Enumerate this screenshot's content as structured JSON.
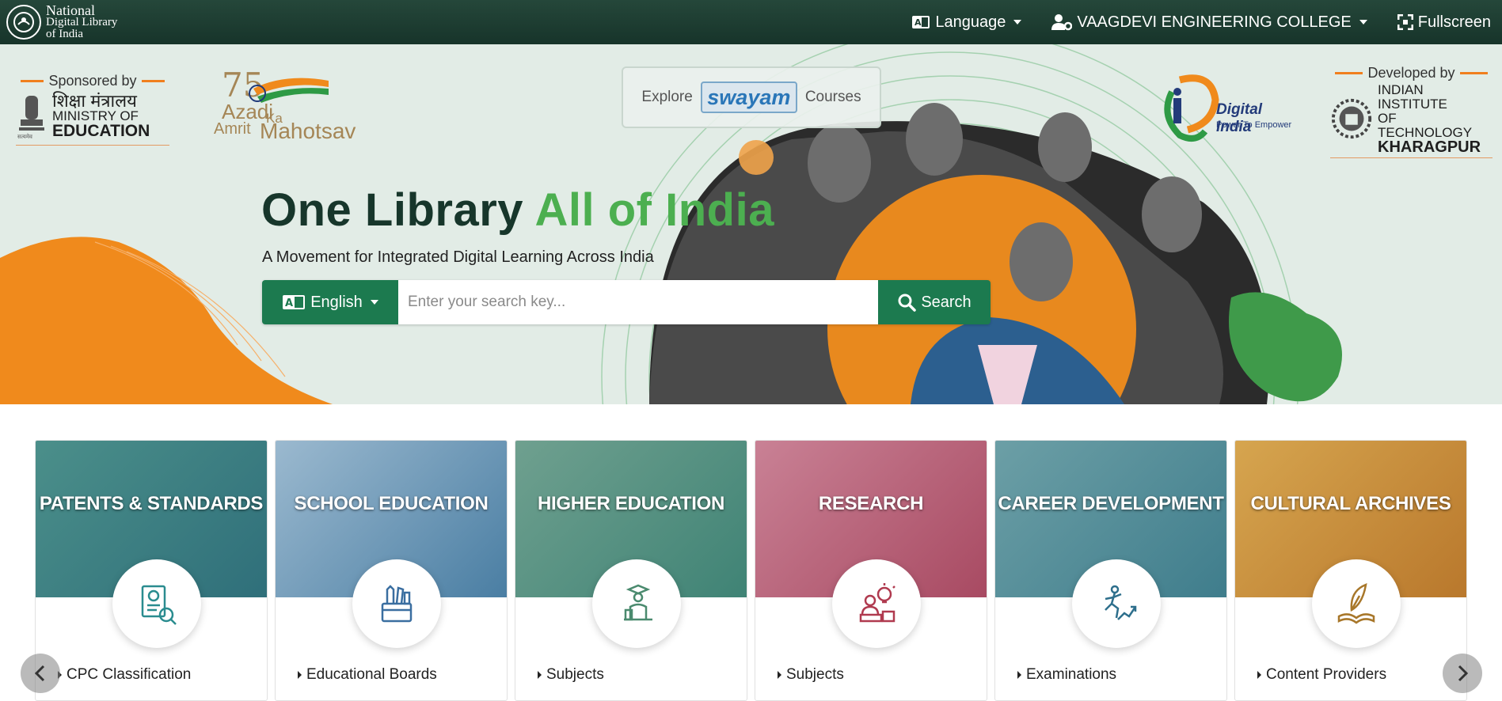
{
  "header": {
    "brand_line1": "National",
    "brand_line2": "Digital Library",
    "brand_line3": "of India",
    "language_label": "Language",
    "institution_label": "VAAGDEVI ENGINEERING COLLEGE",
    "fullscreen_label": "Fullscreen"
  },
  "hero": {
    "sponsored_by": "Sponsored by",
    "ministry_hindi": "शिक्षा मंत्रालय",
    "ministry_line1": "MINISTRY OF",
    "ministry_line2": "EDUCATION",
    "azadi_1": "Azadi",
    "azadi_2": "Ka",
    "azadi_3": "Amrit",
    "azadi_4": "Mahotsav",
    "explore": "Explore",
    "swayam": "swayam",
    "courses": "Courses",
    "digital_india": "Digital India",
    "digital_india_tag": "Power To Empower",
    "developed_by": "Developed by",
    "iit_line1": "INDIAN INSTITUTE",
    "iit_line2": "OF TECHNOLOGY",
    "iit_line3": "KHARAGPUR",
    "headline_part1": "One Library ",
    "headline_part2": "All of India",
    "tagline": "A Movement for Integrated Digital Learning Across India"
  },
  "search": {
    "language": "English",
    "placeholder": "Enter your search key...",
    "button": "Search"
  },
  "cards": [
    {
      "title": "PATENTS & STANDARDS",
      "link": "CPC Classification",
      "tint": "#2f7f86",
      "icon": "patent-document-icon"
    },
    {
      "title": "SCHOOL EDUCATION",
      "link": "Educational Boards",
      "tint": "#4a7ea3",
      "icon": "school-supplies-icon"
    },
    {
      "title": "HIGHER EDUCATION",
      "link": "Subjects",
      "tint": "#3f8375",
      "icon": "graduate-desk-icon"
    },
    {
      "title": "RESEARCH",
      "link": "Subjects",
      "tint": "#b4506a",
      "icon": "research-idea-icon"
    },
    {
      "title": "CAREER DEVELOPMENT",
      "link": "Examinations",
      "tint": "#3f7d8c",
      "icon": "career-growth-icon"
    },
    {
      "title": "CULTURAL ARCHIVES",
      "link": "Content Providers",
      "tint": "#c98a2c",
      "icon": "quill-book-icon"
    }
  ],
  "colors": {
    "primary_green": "#1c7a4f",
    "header_dark": "#1e3d32",
    "accent_orange": "#f08a1c",
    "headline_green": "#4caf50"
  }
}
